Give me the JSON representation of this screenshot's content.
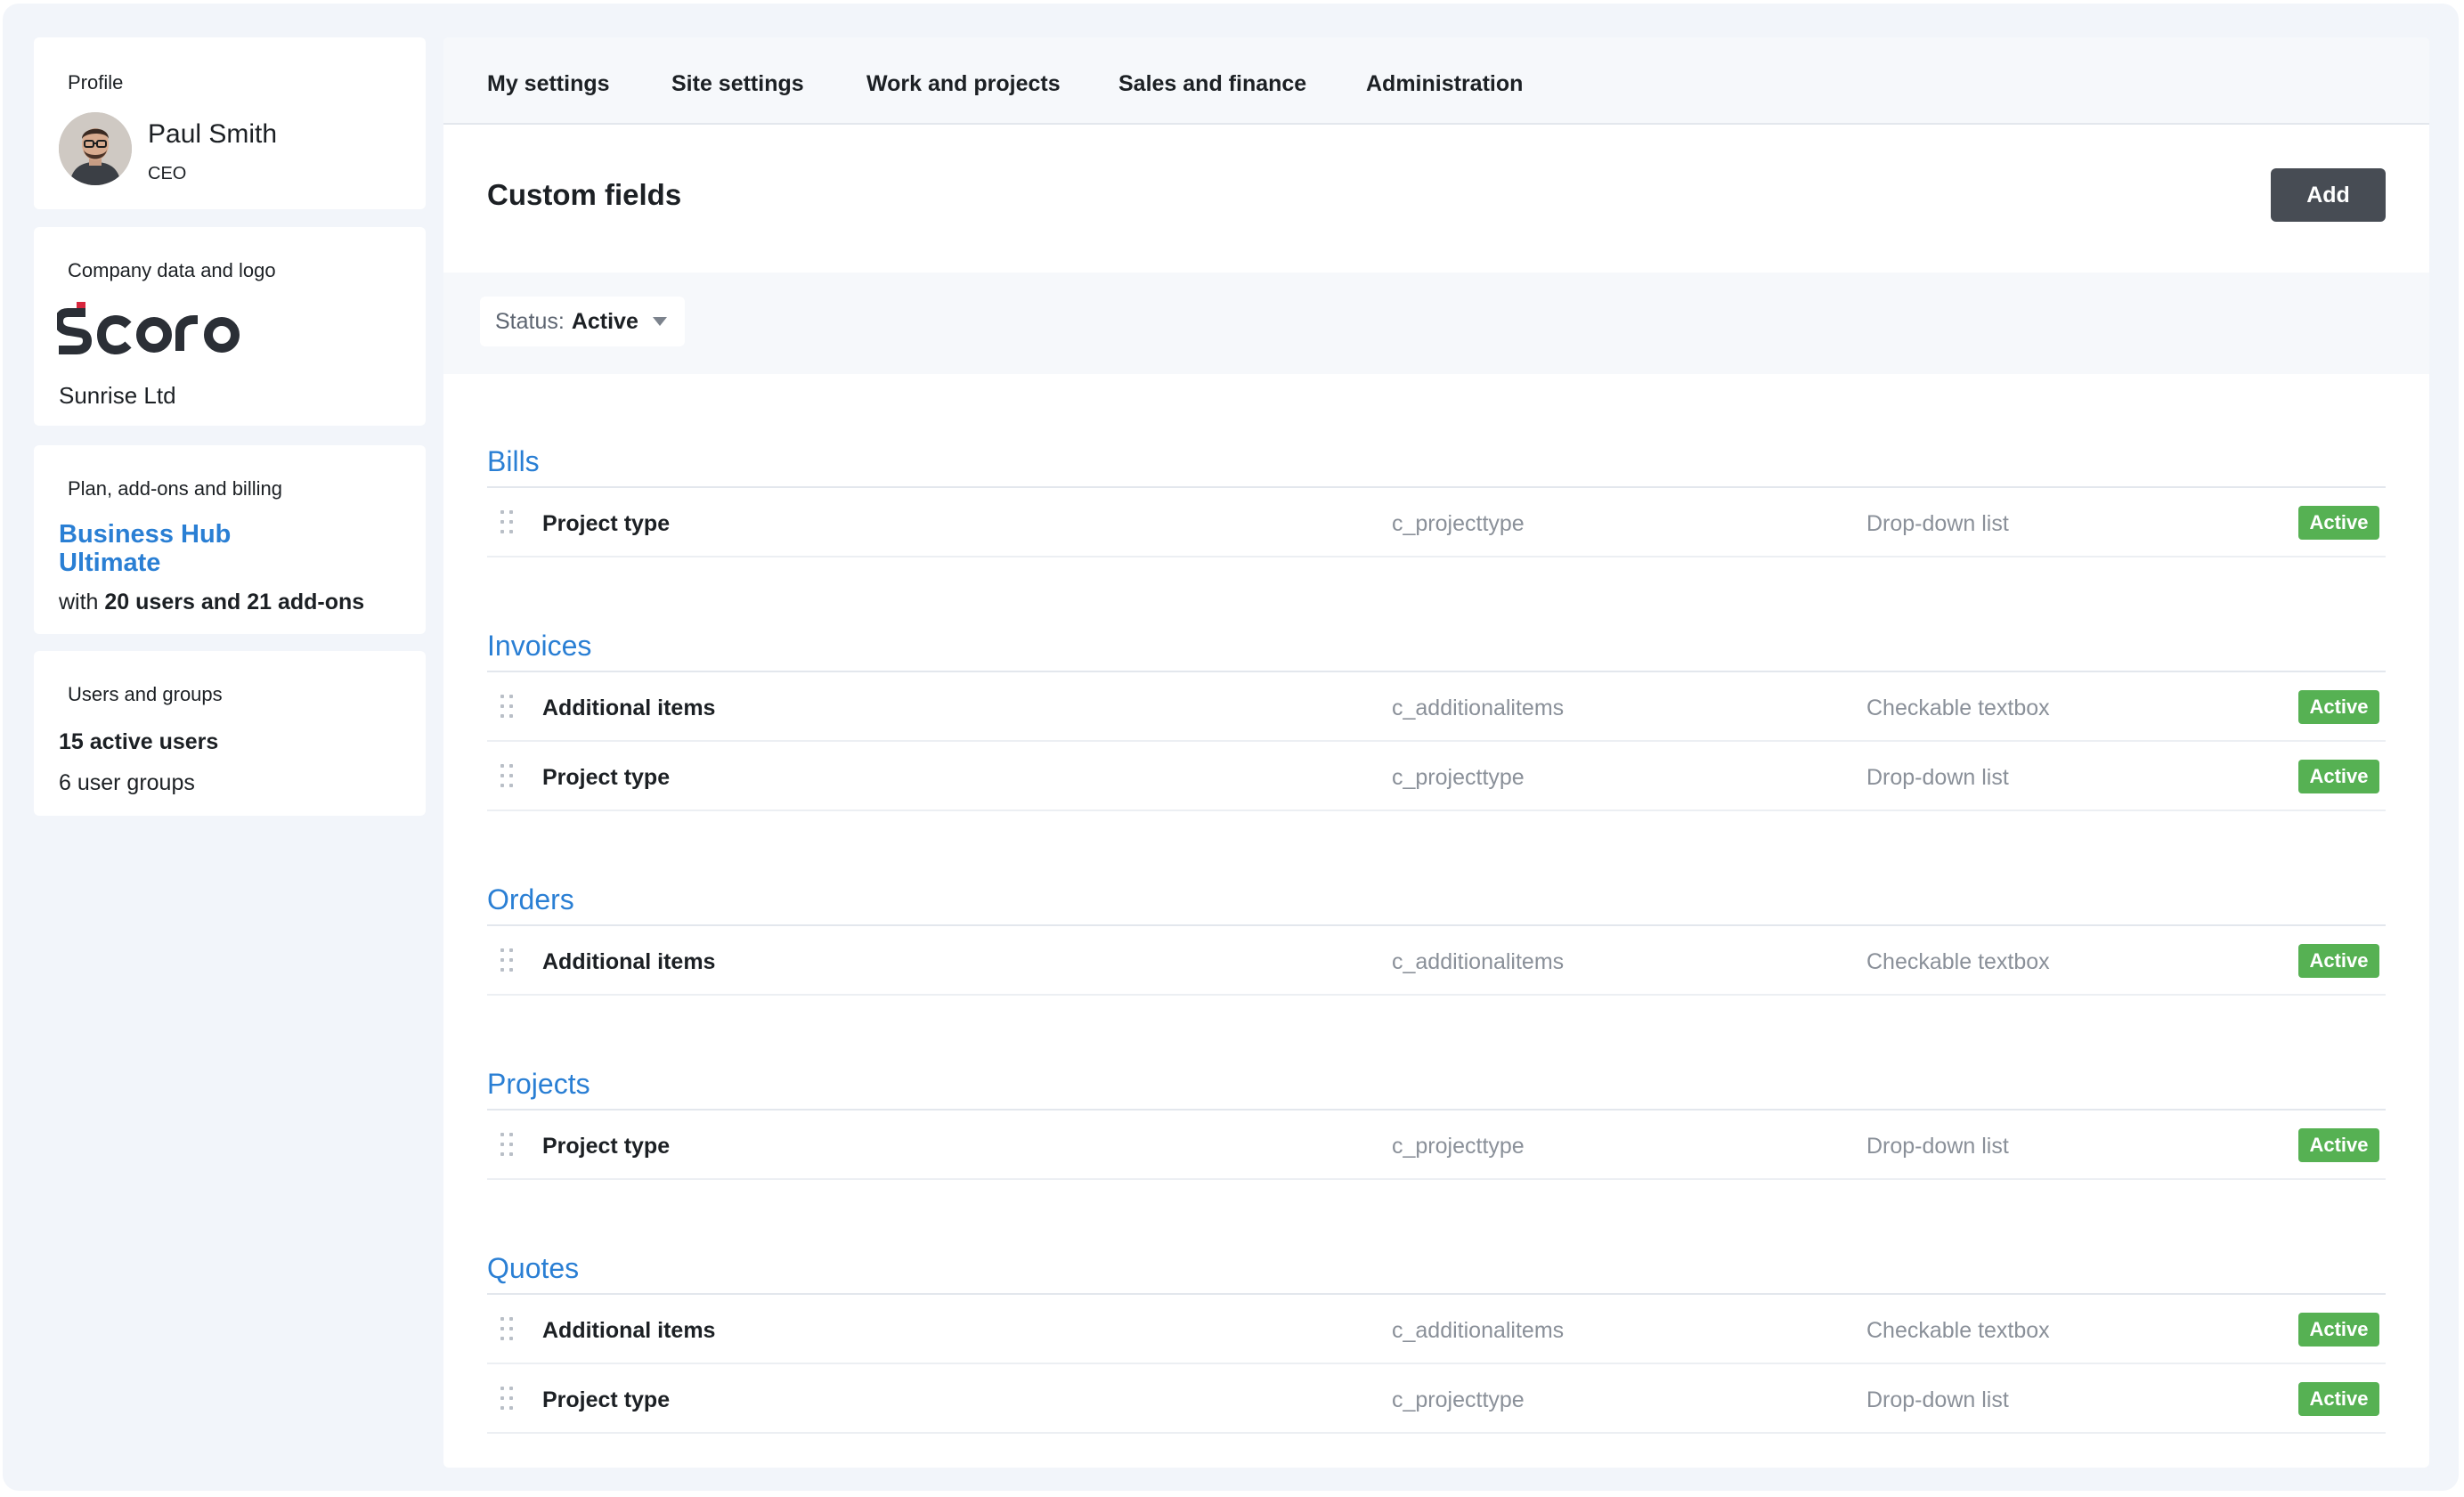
{
  "sidebar": {
    "profile": {
      "title": "Profile",
      "name": "Paul Smith",
      "role": "CEO"
    },
    "company": {
      "title": "Company data and logo",
      "logo": "Scoro",
      "name": "Sunrise Ltd"
    },
    "plan": {
      "title": "Plan, add-ons and billing",
      "name": "Business Hub Ultimate",
      "prefix": "with ",
      "users": "20 users and 21 add-ons"
    },
    "users": {
      "title": "Users and groups",
      "active": "15 active users",
      "groups": "6 user groups"
    }
  },
  "tabs": [
    "My settings",
    "Site settings",
    "Work and projects",
    "Sales and finance",
    "Administration"
  ],
  "page": {
    "title": "Custom fields",
    "add_label": "Add"
  },
  "filter": {
    "label": "Status:",
    "value": "Active"
  },
  "sections": [
    {
      "title": "Bills",
      "rows": [
        {
          "name": "Project type",
          "key": "c_projecttype",
          "type": "Drop-down list",
          "status": "Active"
        }
      ]
    },
    {
      "title": "Invoices",
      "rows": [
        {
          "name": "Additional items",
          "key": "c_additionalitems",
          "type": "Checkable textbox",
          "status": "Active"
        },
        {
          "name": "Project type",
          "key": "c_projecttype",
          "type": "Drop-down list",
          "status": "Active"
        }
      ]
    },
    {
      "title": "Orders",
      "rows": [
        {
          "name": "Additional items",
          "key": "c_additionalitems",
          "type": "Checkable textbox",
          "status": "Active"
        }
      ]
    },
    {
      "title": "Projects",
      "rows": [
        {
          "name": "Project type",
          "key": "c_projecttype",
          "type": "Drop-down list",
          "status": "Active"
        }
      ]
    },
    {
      "title": "Quotes",
      "rows": [
        {
          "name": "Additional items",
          "key": "c_additionalitems",
          "type": "Checkable textbox",
          "status": "Active"
        },
        {
          "name": "Project type",
          "key": "c_projecttype",
          "type": "Drop-down list",
          "status": "Active"
        }
      ]
    }
  ],
  "colors": {
    "accent": "#2a7fd4",
    "active_badge": "#56b153",
    "add_button": "#474c54",
    "logo_red": "#d7263d",
    "logo_dark": "#2b2f36"
  }
}
